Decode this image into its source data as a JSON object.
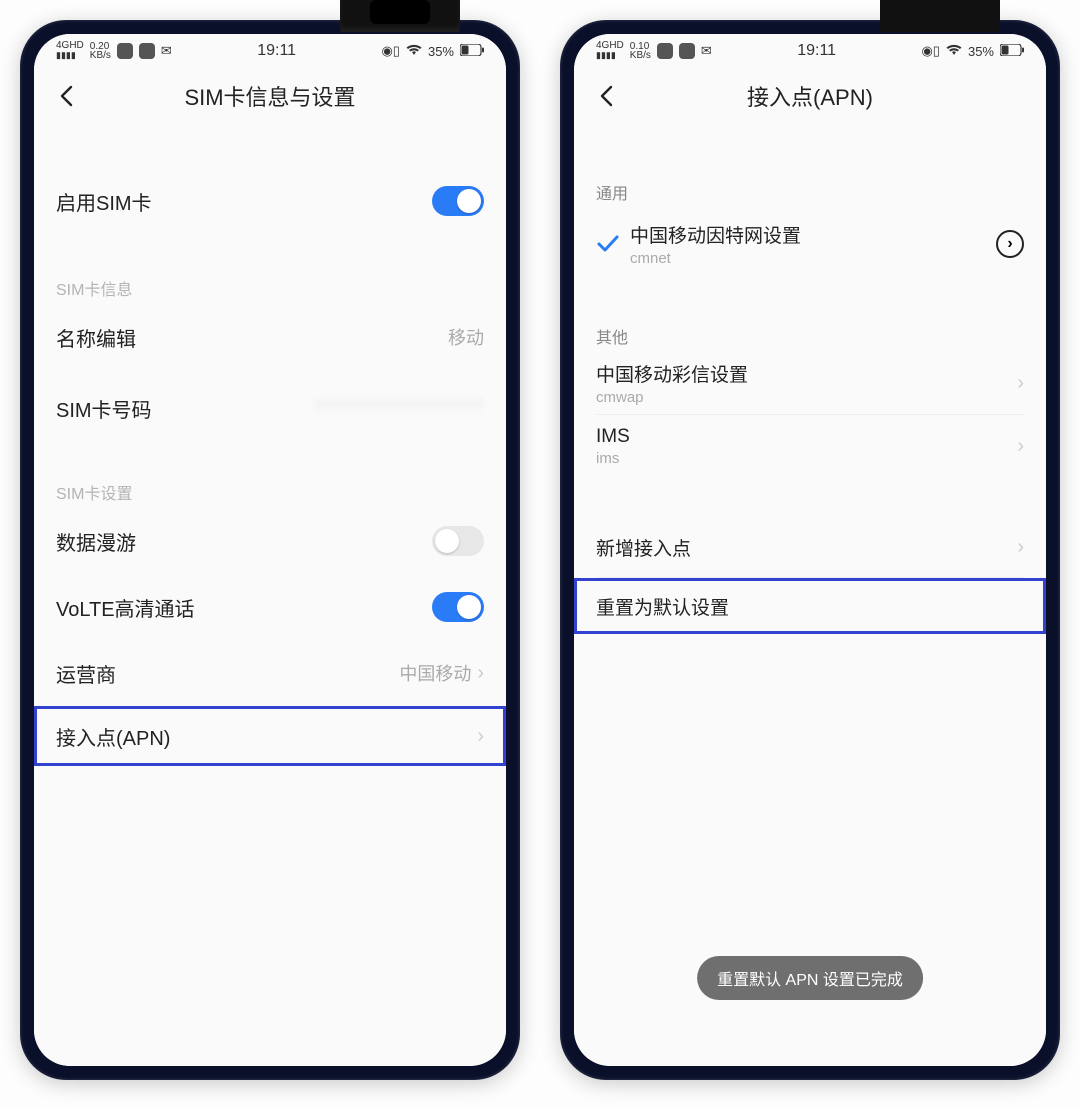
{
  "status": {
    "net_label_a": "4GHD",
    "speed_a": "0.20",
    "speed_unit": "KB/s",
    "speed_b": "0.10",
    "time": "19:11",
    "battery_pct": "35%"
  },
  "phone_a": {
    "title": "SIM卡信息与设置",
    "enable_sim": "启用SIM卡",
    "section_info": "SIM卡信息",
    "name_edit": "名称编辑",
    "name_edit_value": "移动",
    "sim_number": "SIM卡号码",
    "section_settings": "SIM卡设置",
    "roaming": "数据漫游",
    "volte": "VoLTE高清通话",
    "carrier": "运营商",
    "carrier_value": "中国移动",
    "apn": "接入点(APN)"
  },
  "phone_b": {
    "title": "接入点(APN)",
    "section_general": "通用",
    "apn1_title": "中国移动因特网设置",
    "apn1_sub": "cmnet",
    "section_other": "其他",
    "apn2_title": "中国移动彩信设置",
    "apn2_sub": "cmwap",
    "apn3_title": "IMS",
    "apn3_sub": "ims",
    "add_apn": "新增接入点",
    "reset": "重置为默认设置",
    "toast": "重置默认 APN 设置已完成"
  }
}
